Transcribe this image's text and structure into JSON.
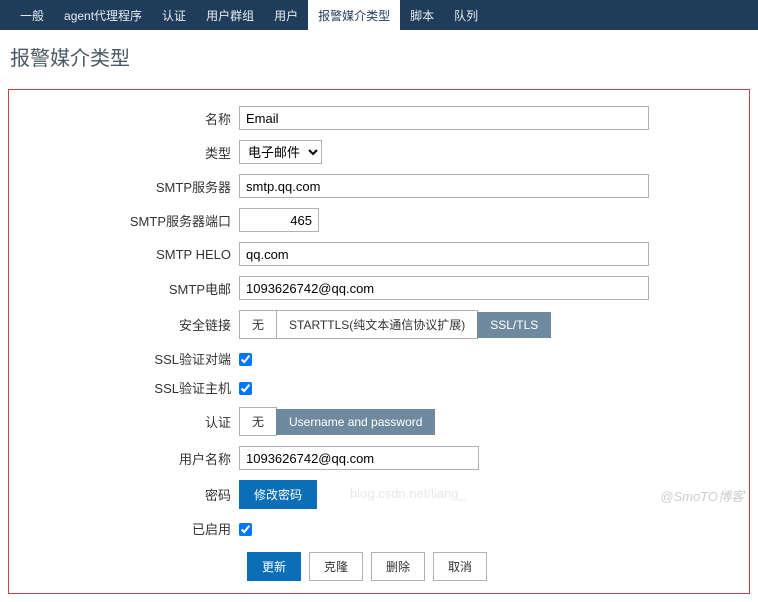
{
  "nav": {
    "items": [
      {
        "label": "一般"
      },
      {
        "label": "agent代理程序"
      },
      {
        "label": "认证"
      },
      {
        "label": "用户群组"
      },
      {
        "label": "用户"
      },
      {
        "label": "报警媒介类型",
        "active": true
      },
      {
        "label": "脚本"
      },
      {
        "label": "队列"
      }
    ]
  },
  "page_title": "报警媒介类型",
  "form": {
    "name_label": "名称",
    "name_value": "Email",
    "type_label": "类型",
    "type_value": "电子邮件",
    "smtp_server_label": "SMTP服务器",
    "smtp_server_value": "smtp.qq.com",
    "smtp_port_label": "SMTP服务器端口",
    "smtp_port_value": "465",
    "smtp_helo_label": "SMTP HELO",
    "smtp_helo_value": "qq.com",
    "smtp_email_label": "SMTP电邮",
    "smtp_email_value": "1093626742@qq.com",
    "security_label": "安全链接",
    "security_opts": {
      "none": "无",
      "starttls": "STARTTLS(纯文本通信协议扩展)",
      "ssltls": "SSL/TLS"
    },
    "ssl_peer_label": "SSL验证对端",
    "ssl_host_label": "SSL验证主机",
    "auth_label": "认证",
    "auth_opts": {
      "none": "无",
      "userpass": "Username and password"
    },
    "username_label": "用户名称",
    "username_value": "1093626742@qq.com",
    "password_label": "密码",
    "password_btn": "修改密码",
    "enabled_label": "已启用"
  },
  "actions": {
    "update": "更新",
    "clone": "克隆",
    "delete": "删除",
    "cancel": "取消"
  },
  "watermark": "@SmoTO博客",
  "watermark2": "blog.csdn.net/liang_"
}
